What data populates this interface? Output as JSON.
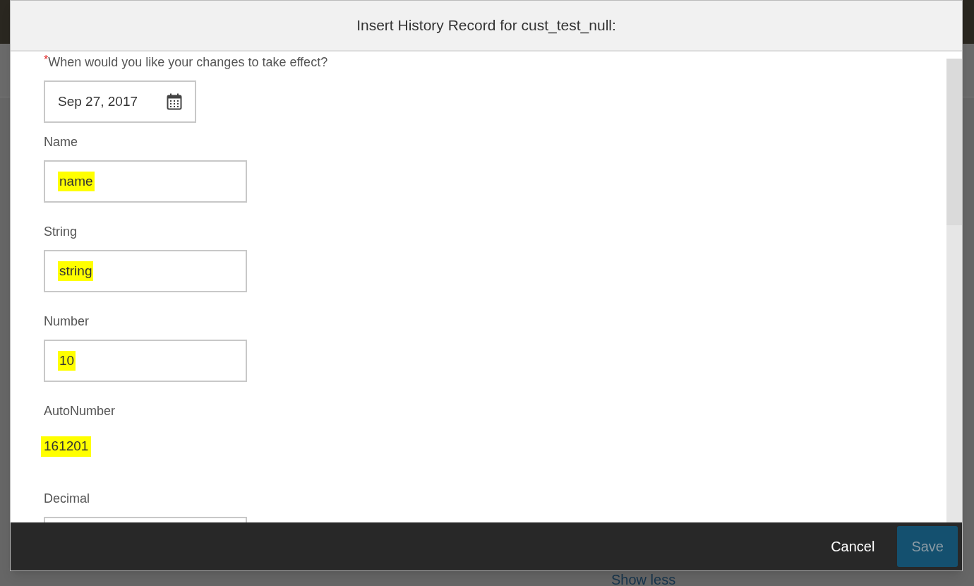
{
  "background": {
    "link": "Show less"
  },
  "dialog": {
    "title": "Insert History Record for cust_test_null:",
    "fields": [
      {
        "kind": "date",
        "label": "When would you like your changes to take effect?",
        "required_mark": "*",
        "value": "Sep 27, 2017"
      },
      {
        "kind": "input",
        "label": "Name",
        "value": "name",
        "highlighted": true
      },
      {
        "kind": "input",
        "label": "String",
        "value": "string",
        "highlighted": true
      },
      {
        "kind": "input",
        "label": "Number",
        "value": "10",
        "highlighted": true
      },
      {
        "kind": "readonly",
        "label": "AutoNumber",
        "value": "161201",
        "highlighted": true
      },
      {
        "kind": "input",
        "label": "Decimal"
      }
    ],
    "buttons": [
      {
        "kind": "link",
        "label": "Cancel",
        "disabled": false
      },
      {
        "kind": "primary",
        "label": "Save",
        "disabled": true
      }
    ]
  }
}
